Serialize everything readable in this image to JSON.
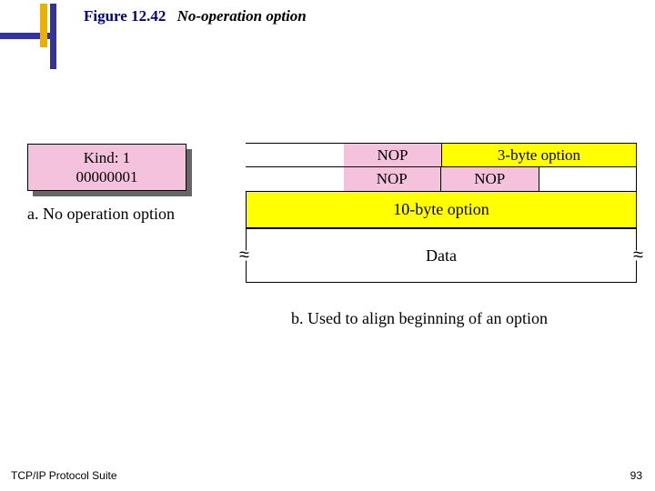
{
  "title": {
    "number": "Figure 12.42",
    "name": "No-operation option"
  },
  "left": {
    "kind_label": "Kind: 1",
    "kind_bits": "00000001",
    "caption": "a. No operation option"
  },
  "right": {
    "nop": "NOP",
    "opt3": "3-byte option",
    "opt10": "10-byte option",
    "data": "Data",
    "caption": "b. Used to align beginning of an option"
  },
  "footer": {
    "suite": "TCP/IP Protocol Suite",
    "page": "93"
  }
}
